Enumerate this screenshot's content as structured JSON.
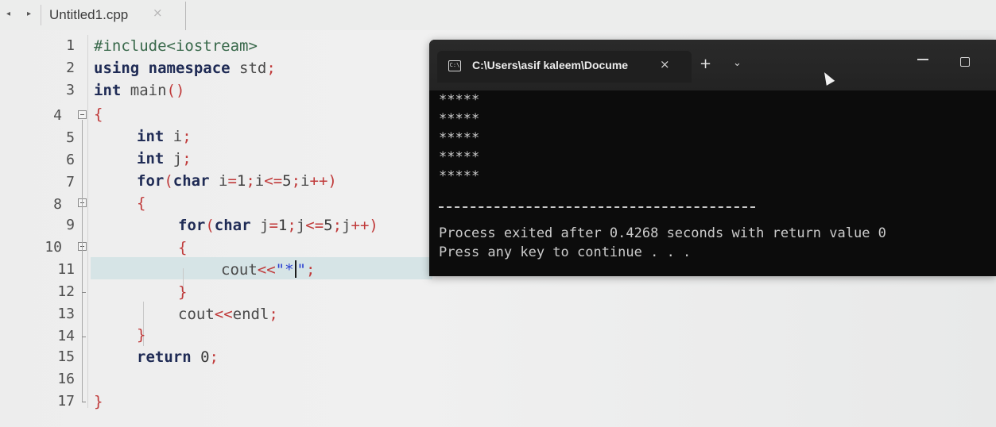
{
  "editor": {
    "tab": {
      "title": "Untitled1.cpp",
      "close_glyph": "×"
    },
    "nav_arrow_left": "◂",
    "nav_arrow_right": "▸",
    "line_numbers": [
      "1",
      "2",
      "3",
      "4",
      "5",
      "6",
      "7",
      "8",
      "9",
      "10",
      "11",
      "12",
      "13",
      "14",
      "15",
      "16",
      "17"
    ],
    "code": {
      "l1": {
        "pp": "#include<iostream>"
      },
      "l2": {
        "kw1": "using",
        "sp1": " ",
        "kw2": "namespace",
        "rest": " std",
        "semi": ";"
      },
      "l3": {
        "kw": "int",
        "rest": " main",
        "paren": "()"
      },
      "l4": {
        "brace": "{"
      },
      "l5": {
        "kw": "int",
        "rest": " i",
        "semi": ";"
      },
      "l6": {
        "kw": "int",
        "rest": " j",
        "semi": ";"
      },
      "l7": {
        "kw": "for",
        "p1": "(",
        "kw2": "char",
        "rest": " i",
        "op1": "=",
        "n1": "1",
        "s1": ";",
        "v1": "i",
        "op2": "<=",
        "n2": "5",
        "s2": ";",
        "v2": "i",
        "op3": "++)"
      },
      "l8": {
        "brace": "{"
      },
      "l9": {
        "kw": "for",
        "p1": "(",
        "kw2": "char",
        "rest": " j",
        "op1": "=",
        "n1": "1",
        "s1": ";",
        "v1": "j",
        "op2": "<=",
        "n2": "5",
        "s2": ";",
        "v2": "j",
        "op3": "++)"
      },
      "l10": {
        "brace": "{"
      },
      "l11": {
        "id": "cout",
        "op": "<<",
        "str_a": "\"*",
        "str_b": "\"",
        "semi": ";"
      },
      "l12": {
        "brace": "}"
      },
      "l13": {
        "id": "cout",
        "op": "<<",
        "rest": "endl",
        "semi": ";"
      },
      "l14": {
        "brace": "}"
      },
      "l15": {
        "kw": "return",
        "num": " 0",
        "semi": ";"
      },
      "l17": {
        "brace": "}"
      }
    }
  },
  "console": {
    "title": "C:\\Users\\asif kaleem\\Docume",
    "close_glyph": "×",
    "new_tab_glyph": "+",
    "dropdown_glyph": "⌄",
    "output_lines": [
      "*****",
      "*****",
      "*****",
      "*****",
      "*****"
    ],
    "exit_message": "Process exited after 0.4268 seconds with return value 0",
    "continue_message": "Press any key to continue . . ."
  }
}
